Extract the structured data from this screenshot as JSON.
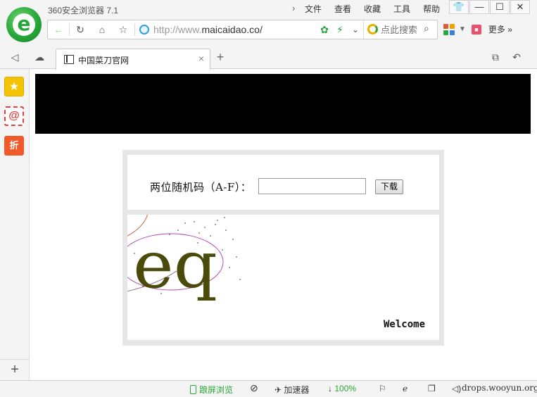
{
  "window": {
    "app_title": "360安全浏览器 7.1",
    "menu": [
      "文件",
      "查看",
      "收藏",
      "工具",
      "帮助"
    ],
    "controls": [
      "shirt-icon",
      "minimize-icon",
      "maximize-icon",
      "close-icon"
    ]
  },
  "address_bar": {
    "url_prefix": "http://www.",
    "url_domain": "maicaidao.co/",
    "search_placeholder": "点此搜索",
    "more_label": "更多 »"
  },
  "tabs": [
    {
      "title": "中国菜刀官网",
      "active": true
    }
  ],
  "page": {
    "form_label": "两位随机码（A-F）：",
    "input_value": "",
    "download_button": "下载",
    "captcha_text": "eq",
    "captcha_color": "#4a4a0a",
    "welcome_text": "Welcome"
  },
  "status_bar": {
    "split_view": "踉屏浏览",
    "accelerator": "加速器",
    "download_progress": "100%",
    "watermark": "drops.wooyun.org"
  },
  "colors": {
    "accent_green": "#27a739",
    "banner": "#000000",
    "panel_border": "#e6e6e6"
  }
}
